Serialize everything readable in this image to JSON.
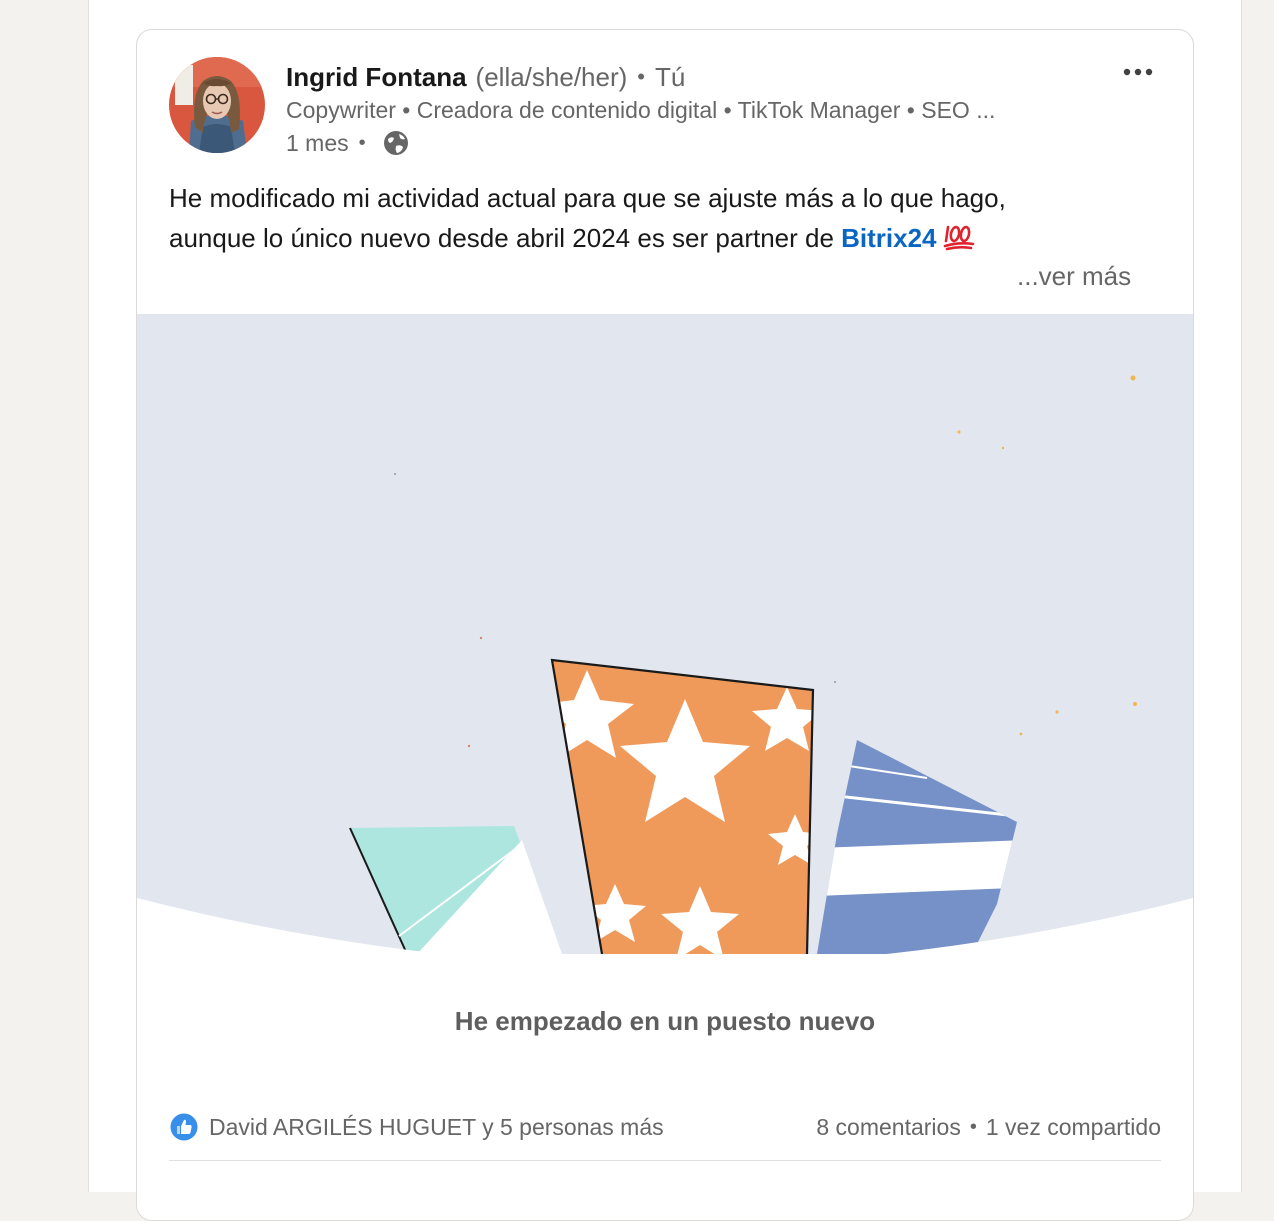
{
  "post": {
    "author": {
      "name": "Ingrid Fontana",
      "pronouns": "(ella/she/her)",
      "separator": "•",
      "badge": "Tú",
      "headline": "Copywriter • Creadora de contenido digital • TikTok Manager • SEO ...",
      "time": "1 mes",
      "time_separator": "•",
      "visibility_icon": "globe-icon"
    },
    "menu_icon": "more-horizontal-icon",
    "text": {
      "line1": "He modificado mi actividad actual para que se ajuste más a lo que hago,",
      "line2_prefix": "aunque lo único nuevo desde abril 2024 es ser partner de ",
      "mention": "Bitrix24",
      "emoji": "hundred-points-emoji",
      "see_more": "...ver más"
    },
    "illustration": {
      "icon": "party-hats-illustration",
      "background": "#e2e7ef"
    },
    "caption": "He empezado en un puesto nuevo",
    "social": {
      "reaction_icon": "like-icon",
      "reactions_text": "David ARGILÉS HUGUET y 5 personas más",
      "comments": "8 comentarios",
      "separator": "•",
      "shares": "1 vez compartido"
    }
  },
  "colors": {
    "page_background": "#f4f2ee",
    "link": "#0a66c2",
    "secondary_text": "#666666",
    "primary_text": "#191919",
    "hat_teal": "#ace6df",
    "hat_orange": "#ef9a5b",
    "hat_blue": "#7591c7"
  }
}
